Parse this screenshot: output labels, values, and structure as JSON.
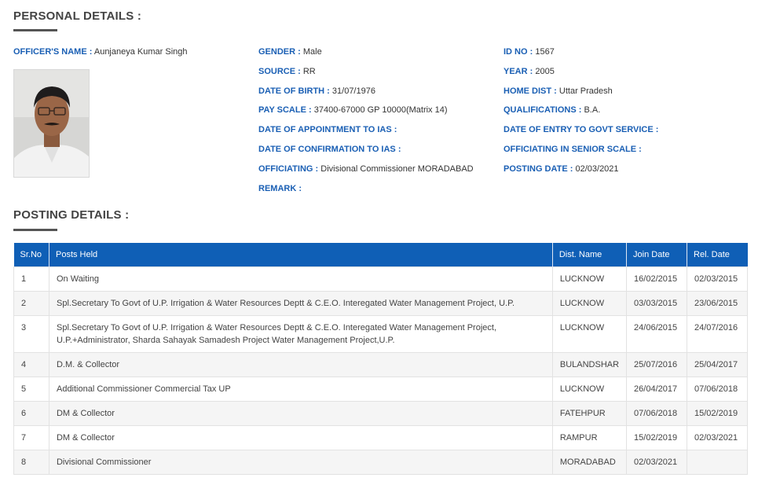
{
  "personal": {
    "heading": "PERSONAL DETAILS :",
    "col1": [
      {
        "label": "OFFICER'S NAME :",
        "value": "Aunjaneya Kumar Singh"
      }
    ],
    "col2": [
      {
        "label": "GENDER :",
        "value": "Male"
      },
      {
        "label": "SOURCE :",
        "value": "RR"
      },
      {
        "label": "DATE OF BIRTH :",
        "value": "31/07/1976"
      },
      {
        "label": "PAY SCALE :",
        "value": "37400-67000 GP 10000(Matrix 14)"
      },
      {
        "label": "DATE OF APPOINTMENT TO IAS :",
        "value": ""
      },
      {
        "label": "DATE OF CONFIRMATION TO IAS :",
        "value": ""
      },
      {
        "label": "OFFICIATING :",
        "value": "Divisional Commissioner MORADABAD"
      },
      {
        "label": "REMARK :",
        "value": ""
      }
    ],
    "col3": [
      {
        "label": "ID NO :",
        "value": "1567"
      },
      {
        "label": "YEAR :",
        "value": "2005"
      },
      {
        "label": "HOME DIST :",
        "value": "Uttar Pradesh"
      },
      {
        "label": "QUALIFICATIONS :",
        "value": "B.A."
      },
      {
        "label": "DATE OF ENTRY TO GOVT SERVICE :",
        "value": ""
      },
      {
        "label": "OFFICIATING IN SENIOR SCALE :",
        "value": ""
      },
      {
        "label": "POSTING DATE :",
        "value": "02/03/2021"
      }
    ]
  },
  "posting": {
    "heading": "POSTING DETAILS :",
    "headers": [
      "Sr.No",
      "Posts Held",
      "Dist. Name",
      "Join Date",
      "Rel. Date"
    ],
    "rows": [
      [
        "1",
        "On Waiting",
        "LUCKNOW",
        "16/02/2015",
        "02/03/2015"
      ],
      [
        "2",
        "Spl.Secretary To Govt of U.P. Irrigation & Water Resources Deptt & C.E.O. Interegated Water Management Project, U.P.",
        "LUCKNOW",
        "03/03/2015",
        "23/06/2015"
      ],
      [
        "3",
        "Spl.Secretary To Govt of U.P. Irrigation & Water Resources Deptt & C.E.O. Interegated Water Management Project, U.P.+Administrator, Sharda Sahayak Samadesh Project Water Management Project,U.P.",
        "LUCKNOW",
        "24/06/2015",
        "24/07/2016"
      ],
      [
        "4",
        "D.M. & Collector",
        "BULANDSHAR",
        "25/07/2016",
        "25/04/2017"
      ],
      [
        "5",
        "Additional Commissioner Commercial Tax UP",
        "LUCKNOW",
        "26/04/2017",
        "07/06/2018"
      ],
      [
        "6",
        "DM & Collector",
        "FATEHPUR",
        "07/06/2018",
        "15/02/2019"
      ],
      [
        "7",
        "DM & Collector",
        "RAMPUR",
        "15/02/2019",
        "02/03/2021"
      ],
      [
        "8",
        "Divisional Commissioner",
        "MORADABAD",
        "02/03/2021",
        ""
      ]
    ]
  },
  "colors": {
    "label_blue": "#1a5fb4",
    "header_blue": "#0f5fb6"
  }
}
